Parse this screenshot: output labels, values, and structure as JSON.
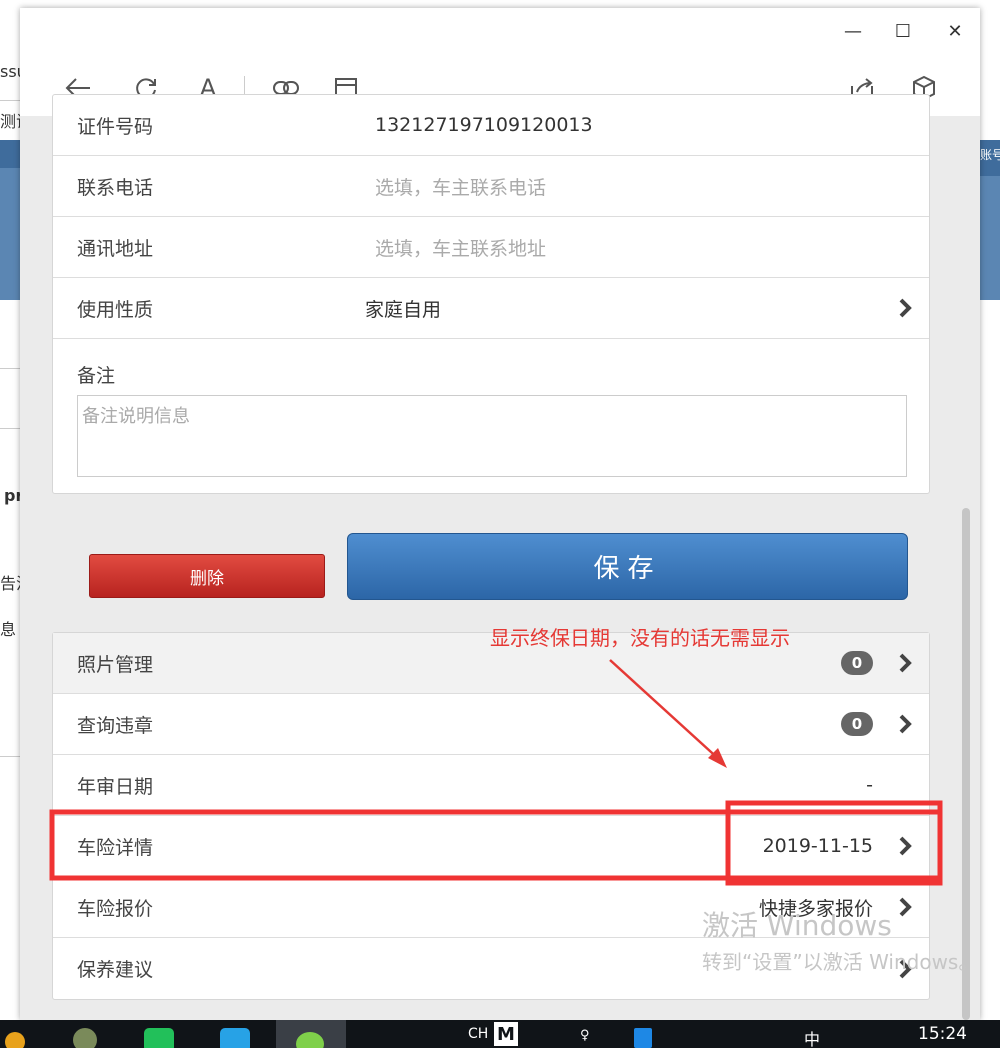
{
  "background": {
    "left_fragments": [
      "ssu",
      "测试",
      "pr",
      "告注",
      "息"
    ],
    "right_fragment": "账号"
  },
  "window": {
    "controls": {
      "minimize": "—",
      "maximize": "☐",
      "close": "✕"
    },
    "toolbar_text_icon": "A"
  },
  "form": {
    "id_number": {
      "label": "证件号码",
      "value": "132127197109120013"
    },
    "phone": {
      "label": "联系电话",
      "placeholder": "选填，车主联系电话"
    },
    "address": {
      "label": "通讯地址",
      "placeholder": "选填，车主联系地址"
    },
    "usage": {
      "label": "使用性质",
      "value": "家庭自用"
    },
    "remark": {
      "label": "备注",
      "placeholder": "备注说明信息"
    }
  },
  "buttons": {
    "delete_label": "删除",
    "save_label": "保存"
  },
  "menu": {
    "photos": {
      "label": "照片管理",
      "count": "0"
    },
    "violations": {
      "label": "查询违章",
      "count": "0"
    },
    "inspection": {
      "label": "年审日期",
      "value": "-"
    },
    "insurance": {
      "label": "车险详情",
      "value": "2019-11-15"
    },
    "quote": {
      "label": "车险报价",
      "value": "快捷多家报价"
    },
    "maintenance": {
      "label": "保养建议"
    }
  },
  "annotation": {
    "text": "显示终保日期，没有的话无需显示",
    "color": "#e53935"
  },
  "watermark": {
    "line1": "激活 Windows",
    "line2": "转到“设置”以激活 Windows。"
  },
  "taskbar": {
    "lang": "CH",
    "ime": "M",
    "ime_cn": "中",
    "time": "15:24"
  }
}
